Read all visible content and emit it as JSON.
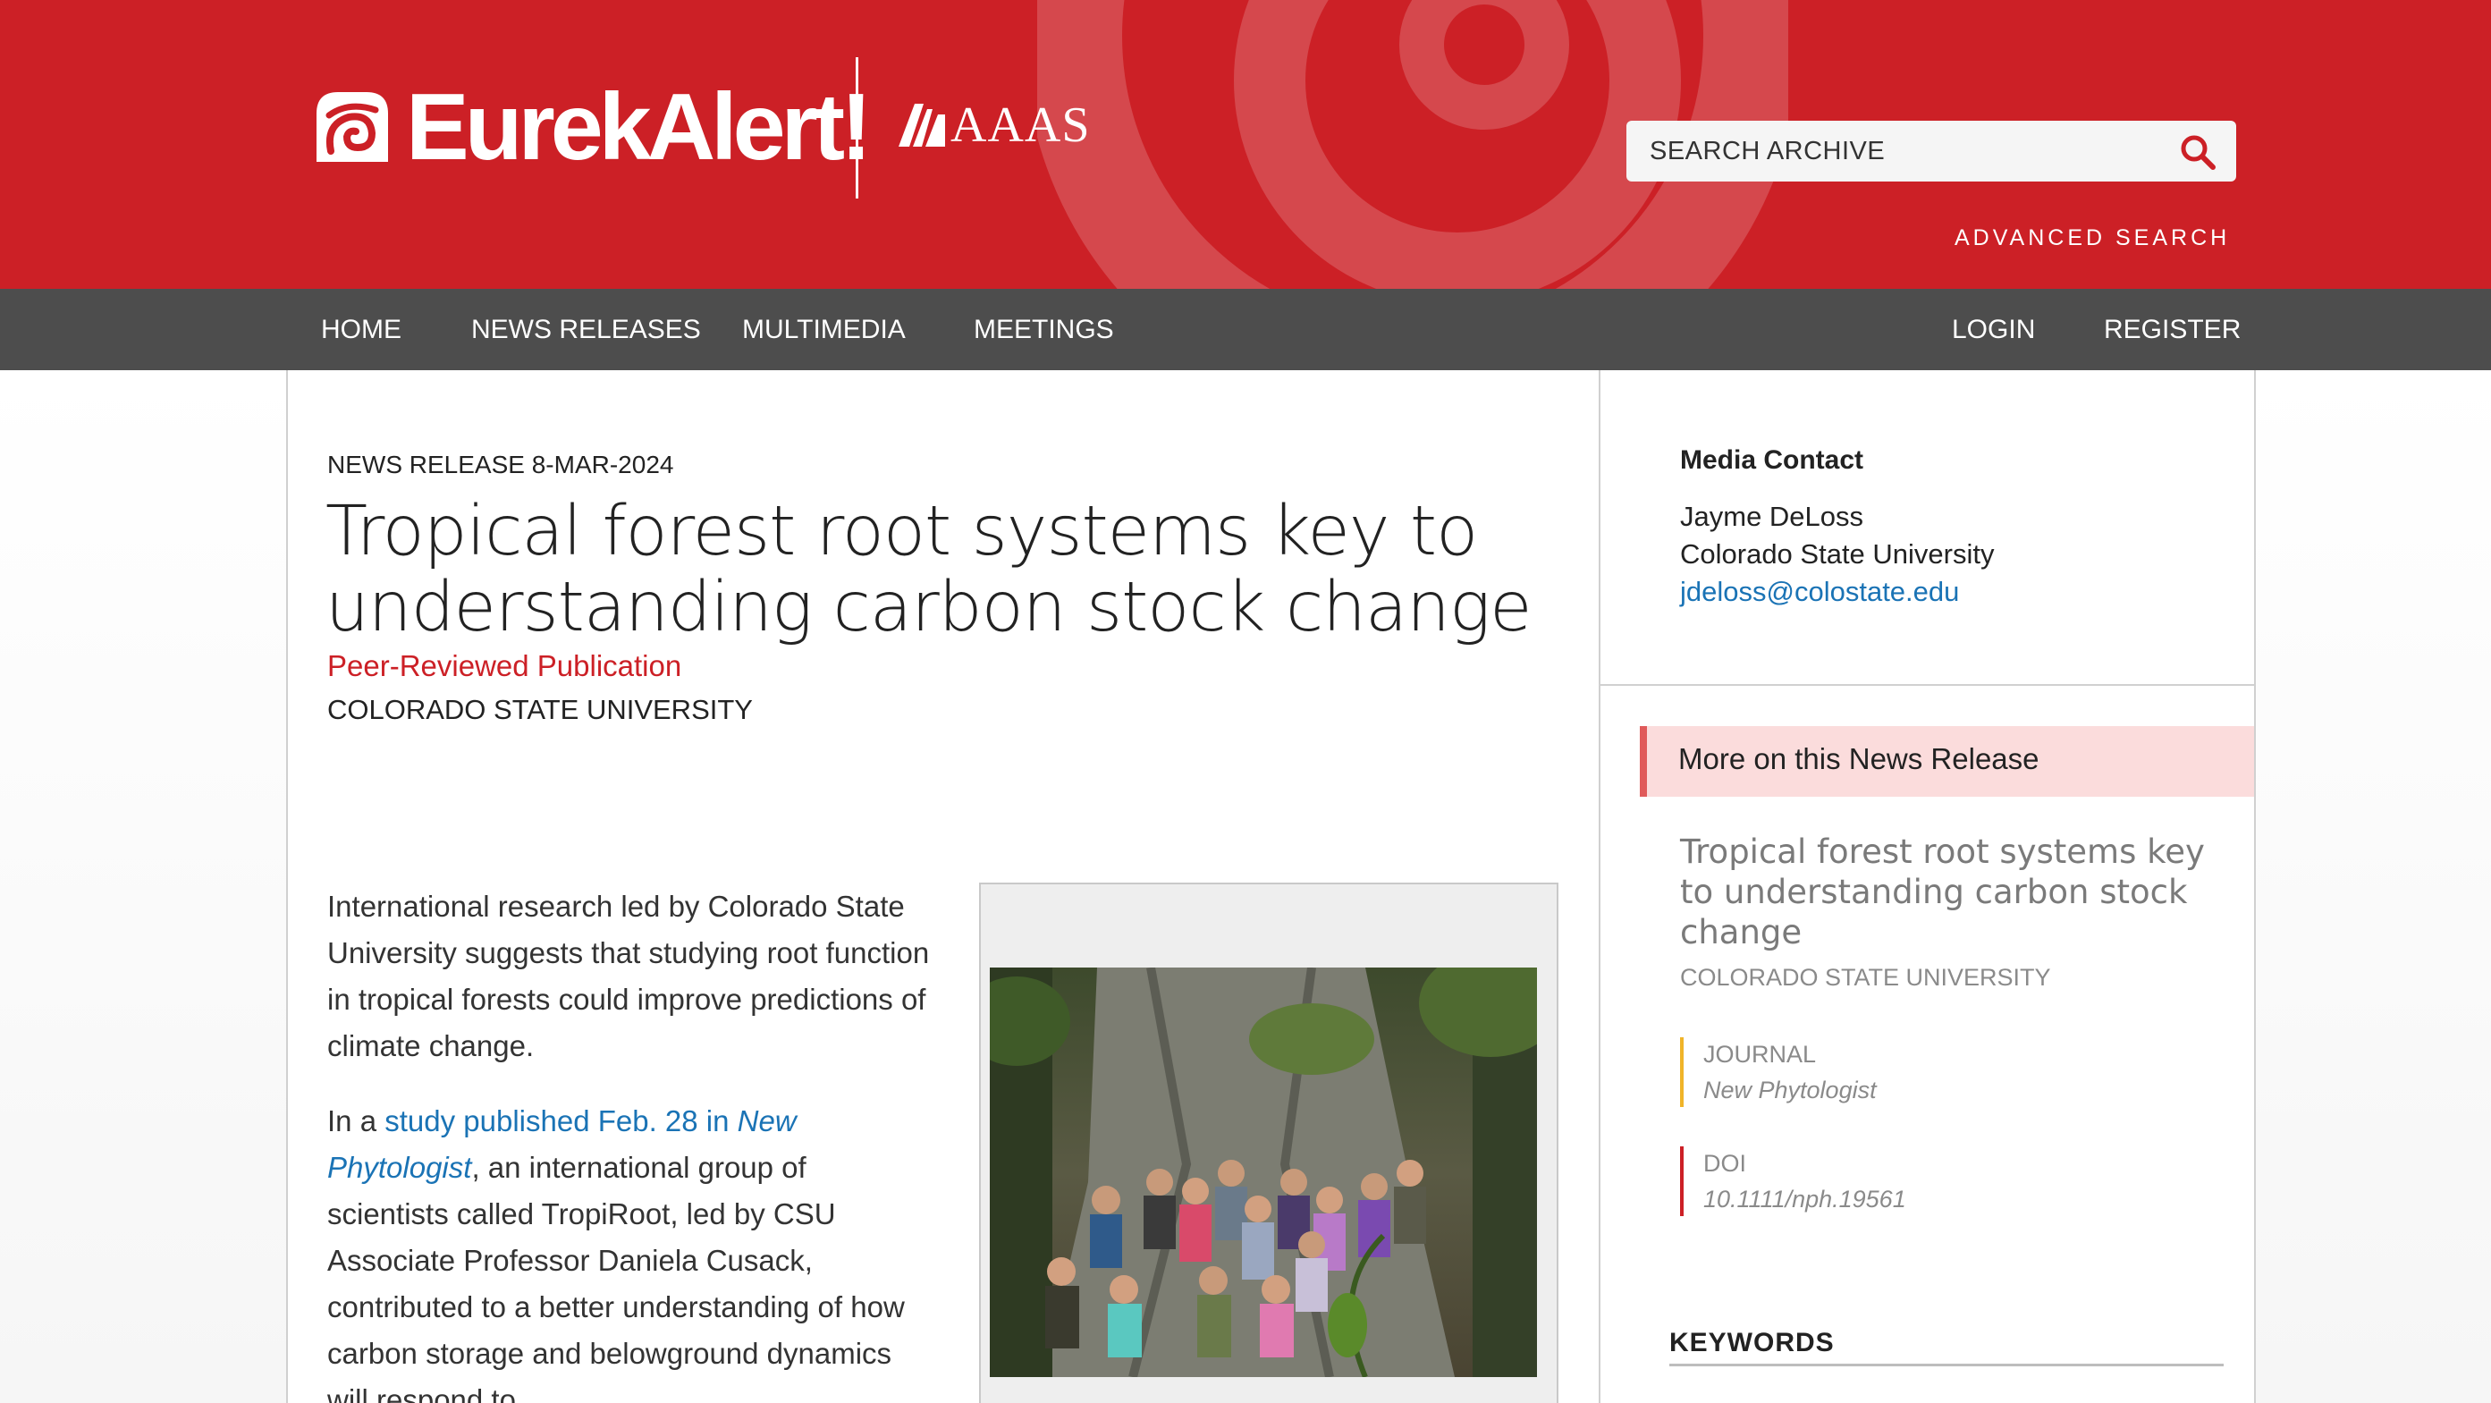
{
  "header": {
    "logo_text": "EurekAlert!",
    "partner_text": "AAAS",
    "search_placeholder": "SEARCH ARCHIVE",
    "advanced_search": "ADVANCED SEARCH",
    "brand_color": "#cc2026"
  },
  "nav": {
    "items": [
      "HOME",
      "NEWS RELEASES",
      "MULTIMEDIA",
      "MEETINGS"
    ],
    "login": "LOGIN",
    "register": "REGISTER",
    "bg_color": "#4d4d4d"
  },
  "article": {
    "release_date": "NEWS RELEASE 8-MAR-2024",
    "headline_line1": "Tropical forest root systems key to",
    "headline_line2": "understanding carbon stock change",
    "pub_type": "Peer-Reviewed Publication",
    "institution": "COLORADO STATE UNIVERSITY",
    "p1": "International research led by Colorado State University suggests that studying root function in tropical forests could improve predictions of climate change.",
    "p2_prefix": "In a ",
    "p2_link": "study published Feb. 28 in ",
    "p2_link_italic": "New Phytologist",
    "p2_rest": ", an international group of scientists called TropiRoot, led by CSU Associate Professor Daniela Cusack, contributed to a better understanding of how carbon storage and belowground dynamics will respond to",
    "photo_alt": "Group of researchers standing in front of a large tropical tree"
  },
  "sidebar": {
    "media_contact_heading": "Media Contact",
    "contact_name": "Jayme DeLoss",
    "contact_org": "Colorado State University",
    "contact_email": "jdeloss@colostate.edu",
    "more_label": "More on this News Release",
    "more_title": "Tropical forest root systems key to understanding carbon stock change",
    "more_institution": "COLORADO STATE UNIVERSITY",
    "journal_label": "JOURNAL",
    "journal_value": "New Phytologist",
    "doi_label": "DOI",
    "doi_value": "10.1111/nph.19561",
    "keywords_heading": "KEYWORDS",
    "journal_bar_color": "#f0b429",
    "doi_bar_color": "#cc2026"
  }
}
